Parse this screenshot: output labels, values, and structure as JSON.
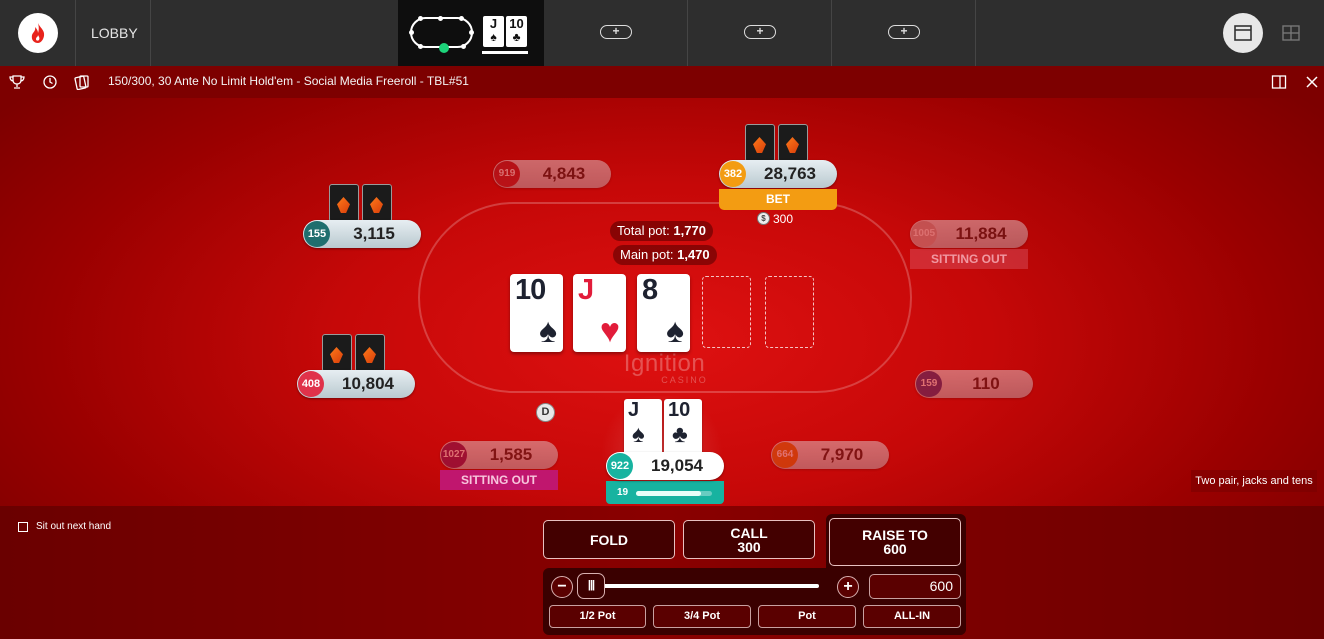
{
  "nav": {
    "lobby": "LOBBY",
    "add_label": "+",
    "mini_cards": [
      {
        "rank": "J",
        "suit": "♠"
      },
      {
        "rank": "10",
        "suit": "♣"
      }
    ]
  },
  "table": {
    "title": "150/300, 30 Ante No Limit Hold'em - Social Media Freeroll - TBL#51",
    "brand": "Ignition",
    "brand_sub": "CASINO",
    "dealer_button": "D"
  },
  "pot": {
    "total_label": "Total pot:",
    "total_value": "1,770",
    "main_label": "Main pot:",
    "main_value": "1,470"
  },
  "board": [
    {
      "rank": "10",
      "suit": "♠",
      "color": "black"
    },
    {
      "rank": "J",
      "suit": "♥",
      "color": "red"
    },
    {
      "rank": "8",
      "suit": "♠",
      "color": "black"
    }
  ],
  "seats": {
    "s919": {
      "rank": "919",
      "stack": "4,843"
    },
    "s382": {
      "rank": "382",
      "stack": "28,763",
      "action": "BET",
      "bet": "300",
      "chip": "$"
    },
    "s155": {
      "rank": "155",
      "stack": "3,115"
    },
    "s1005": {
      "rank": "1005",
      "stack": "11,884",
      "status": "SITTING OUT"
    },
    "s408": {
      "rank": "408",
      "stack": "10,804"
    },
    "s159": {
      "rank": "159",
      "stack": "110"
    },
    "s1027": {
      "rank": "1027",
      "stack": "1,585",
      "status": "SITTING OUT"
    },
    "s664": {
      "rank": "664",
      "stack": "7,970"
    },
    "hero": {
      "rank": "922",
      "stack": "19,054",
      "timer": "19",
      "timer_fraction": 0.85
    }
  },
  "hero_cards": [
    {
      "rank": "J",
      "suit": "♠"
    },
    {
      "rank": "10",
      "suit": "♣"
    }
  ],
  "hand_description": "Two pair, jacks and tens",
  "controls": {
    "sit_out_label": "Sit out next hand",
    "fold": "FOLD",
    "call_label": "CALL",
    "call_amount": "300",
    "raise_label": "RAISE TO",
    "raise_amount": "600",
    "minus": "−",
    "plus": "+",
    "slider_grip": "|||",
    "amount": "600",
    "presets": [
      "1/2 Pot",
      "3/4 Pot",
      "Pot",
      "ALL-IN"
    ]
  },
  "colors": {
    "felt": "#c60808",
    "bet_orange": "#f39c12",
    "hero_teal": "#17b3a0",
    "sitting_out": "#c0166e"
  }
}
